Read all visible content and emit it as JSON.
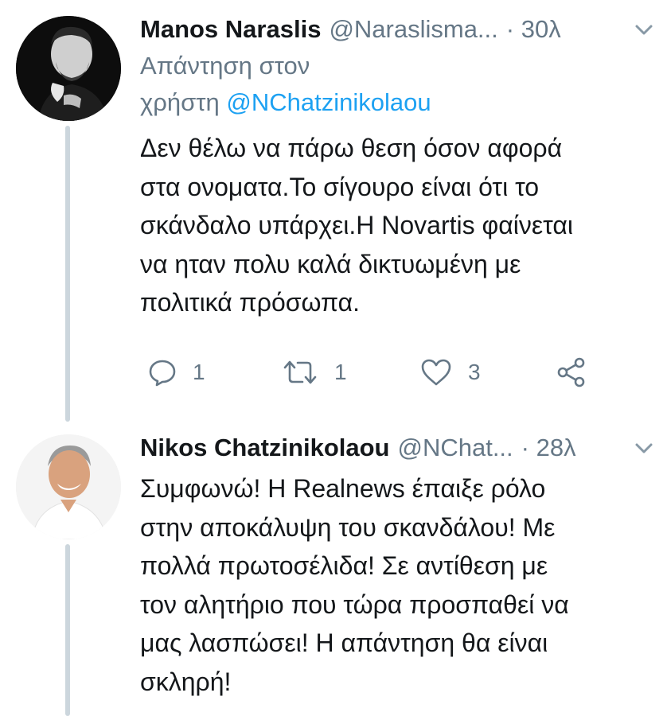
{
  "tweets": [
    {
      "name": "Manos Naraslis",
      "handle": "@Naraslisma...",
      "time": "· 30λ",
      "reply_prefix": "Απάντηση στον",
      "reply_user_word": "χρήστη",
      "reply_mention": "@NChatzinikolaou",
      "text": "Δεν θέλω να πάρω θεση όσον αφορά\nστα ονοματα.Το σίγουρο είναι ότι το\nσκάνδαλο υπάρχει.Η Novartis φαίνεται\nνα ηταν πολυ καλά δικτυωμένη με\nπολιτικά πρόσωπα.",
      "replies": "1",
      "retweets": "1",
      "likes": "3",
      "avatar_icon": "man-portrait-avatar"
    },
    {
      "name": "Nikos Chatzinikolaou",
      "handle": "@NChat...",
      "time": "· 28λ",
      "text": "Συμφωνώ! Η Realnews έπαιξε ρόλο\nστην αποκάλυψη του σκανδάλου! Με\nπολλά πρωτοσέλιδα! Σε αντίθεση με\nτον αλητήριο που τώρα προσπαθεί να\nμας λασπώσει! Η απάντηση θα είναι\nσκληρή!",
      "avatar_icon": "man-portrait-avatar"
    }
  ],
  "colors": {
    "text": "#14171a",
    "secondary": "#657786",
    "link": "#1da1f2",
    "thread_line": "#ccd6dd"
  }
}
